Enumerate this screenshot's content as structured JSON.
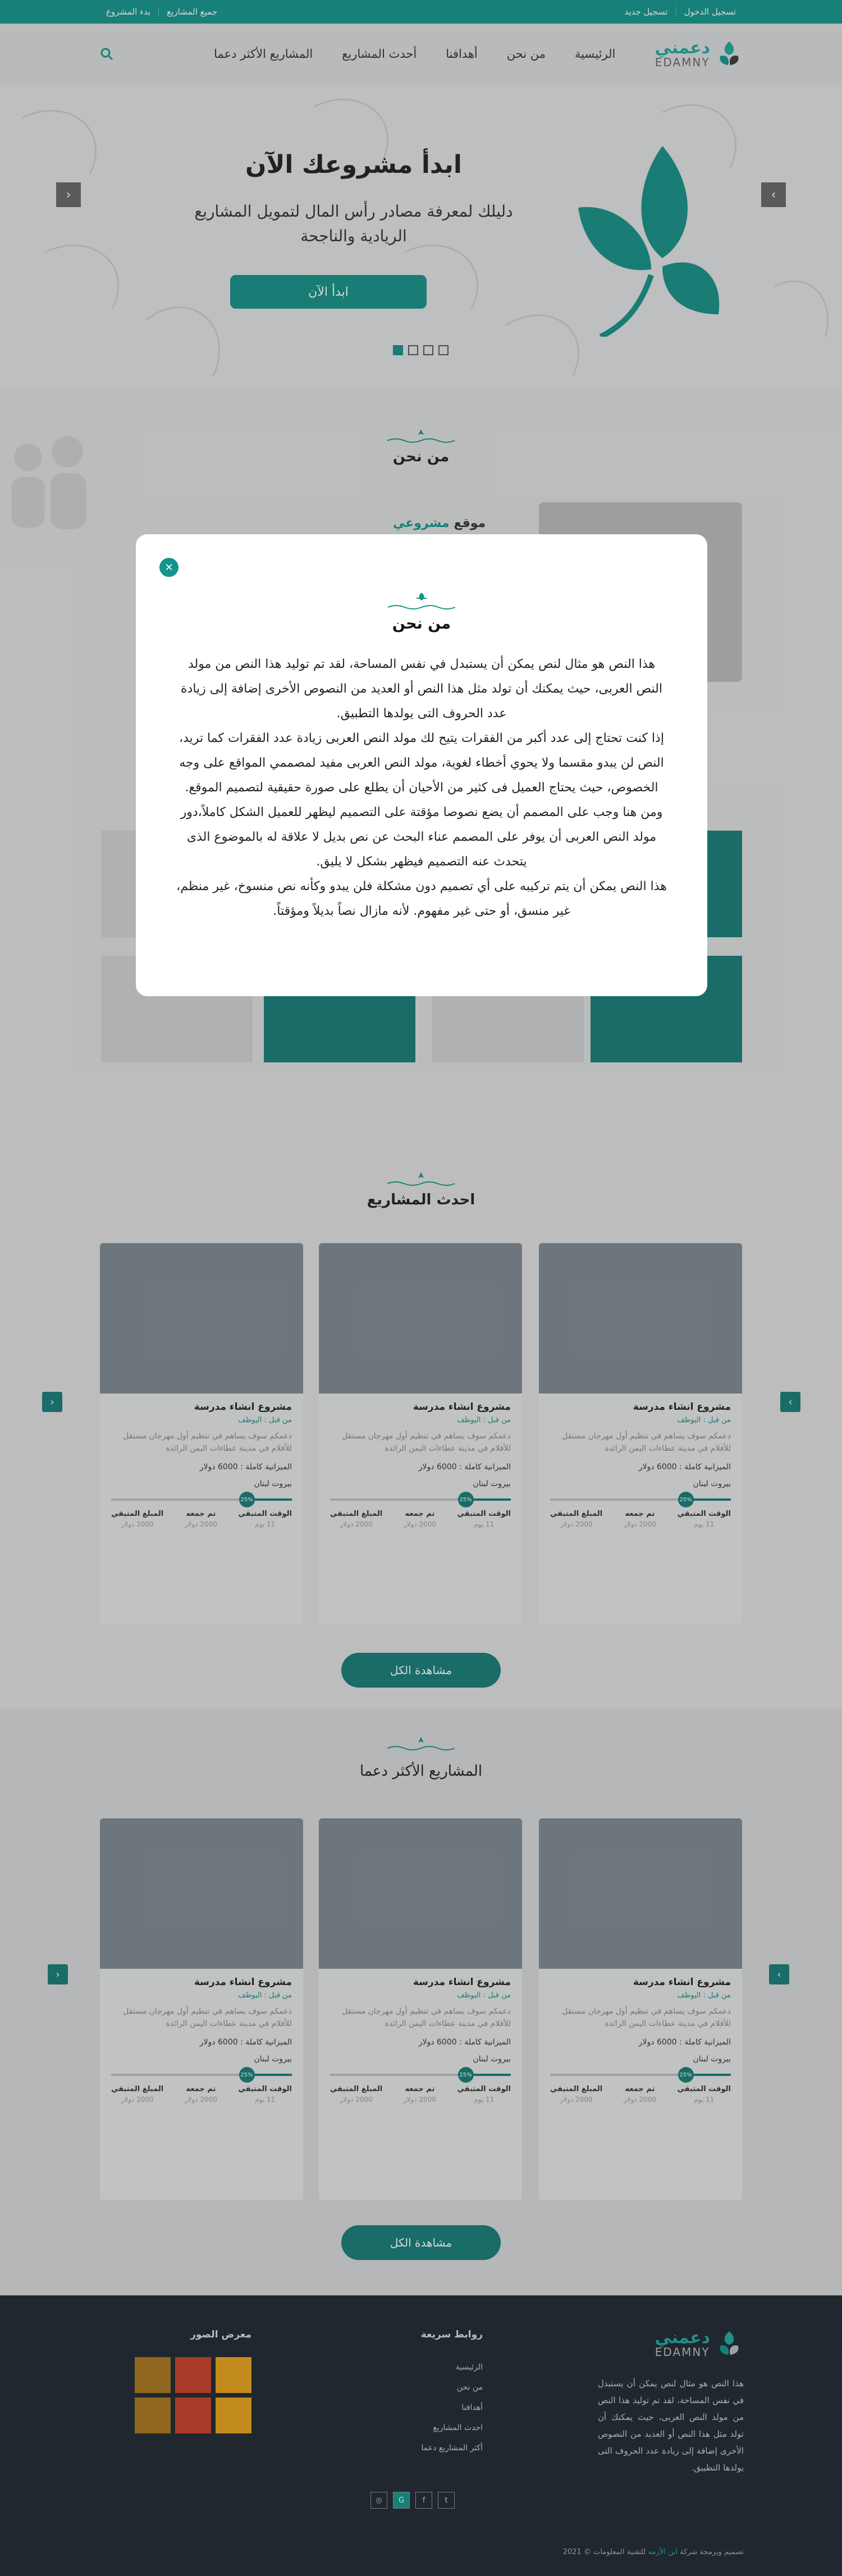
{
  "topbar": {
    "register": "تسجيل جديد",
    "login": "تسجيل الدخول",
    "all_projects": "جميع المشاريع",
    "start_project": "بدء المشروع"
  },
  "header": {
    "logo_ar": "دعمني",
    "logo_en": "EDAMNY",
    "nav": [
      "الرئيسية",
      "من نحن",
      "أهدافنا",
      "أحدث المشاريع",
      "المشاريع الأكثر دعما"
    ]
  },
  "hero": {
    "title": "ابدأ مشروعك الآن",
    "subtitle": "دليلك لمعرفة مصادر رأس المال لتمويل المشاريع الريادية والناجحة",
    "button": "ابدأ الآن",
    "prev": "‹",
    "next": "›"
  },
  "about": {
    "title": "من نحن",
    "site_prefix": "موقع",
    "site_name": "مشروعي"
  },
  "projects": {
    "title": "احدث المشاريع",
    "view_all": "مشاهدة الكل",
    "cards": [
      {
        "title": "مشروع انشاء مدرسة",
        "by": "من قبل : اليوظف",
        "desc": "دعمكم سوف يساهم في تنظيم أول مهرجان مستقل للأفلام في مدينة عطاءات اليمن الرائدة",
        "budget": "الميزانية كاملة : 6000 دولار",
        "location": "بيروت لبنان",
        "progress": "25%",
        "remaining_label": "الوقت المتبقي",
        "remaining": "11 يوم",
        "donors_label": "تم جمعه",
        "donors": "2000 دولار",
        "goal_label": "المبلغ المتبقي",
        "goal": "2000 دولار"
      },
      {
        "title": "مشروع انشاء مدرسة",
        "by": "من قبل : اليوظف",
        "desc": "دعمكم سوف يساهم في تنظيم أول مهرجان مستقل للأفلام في مدينة عطاءات اليمن الرائدة",
        "budget": "الميزانية كاملة : 6000 دولار",
        "location": "بيروت لبنان",
        "progress": "25%",
        "remaining_label": "الوقت المتبقي",
        "remaining": "11 يوم",
        "donors_label": "تم جمعه",
        "donors": "2000 دولار",
        "goal_label": "المبلغ المتبقي",
        "goal": "2000 دولار"
      },
      {
        "title": "مشروع انشاء مدرسة",
        "by": "من قبل : اليوظف",
        "desc": "دعمكم سوف يساهم في تنظيم أول مهرجان مستقل للأفلام في مدينة عطاءات اليمن الرائدة",
        "budget": "الميزانية كاملة : 6000 دولار",
        "location": "بيروت لبنان",
        "progress": "25%",
        "remaining_label": "الوقت المتبقي",
        "remaining": "11 يوم",
        "donors_label": "تم جمعه",
        "donors": "2000 دولار",
        "goal_label": "المبلغ المتبقي",
        "goal": "2000 دولار"
      }
    ]
  },
  "supported": {
    "title": "المشاريع الأكثر دعما",
    "view_all": "مشاهدة الكل"
  },
  "footer": {
    "about": "هذا النص هو مثال لنص يمكن أن يستبدل في نفس المساحة، لقد تم توليد هذا النص من مولد النص العربى، حيث يمكنك أن تولد مثل هذا النص أو العديد من النصوص الأخرى إضافة إلى زيادة عدد الحروف التى يولدها التطبيق.",
    "links_title": "روابط سريعة",
    "links": [
      "الرئيسية",
      "من نحن",
      "أهدافنا",
      "احدث المشاريع",
      "أكثر المشاريع دعما"
    ],
    "gallery_title": "معرض الصور",
    "copyright_prefix": "تصميم وبرمجة شركة",
    "copyright_company": "ابن الأزمه",
    "copyright_suffix": "للتقنية المعلومات © 2021"
  },
  "modal": {
    "title": "من نحن",
    "paragraphs": [
      "هذا النص هو مثال لنص يمكن أن يستبدل في نفس المساحة، لقد تم توليد هذا النص من مولد النص العربى، حيث يمكنك أن تولد مثل هذا النص أو العديد من النصوص الأخرى إضافة إلى زيادة عدد الحروف التى يولدها التطبيق.",
      "إذا كنت تحتاج إلى عدد أكبر من الفقرات يتيح لك مولد النص العربى زيادة عدد الفقرات كما تريد، النص لن يبدو مقسما ولا يحوي أخطاء لغوية، مولد النص العربى مفيد لمصممي المواقع على وجه الخصوص، حيث يحتاج العميل فى كثير من الأحيان أن يطلع على صورة حقيقية لتصميم الموقع.",
      "ومن هنا وجب على المصمم أن يضع نصوصا مؤقتة على التصميم ليظهر للعميل الشكل كاملاً،دور مولد النص العربى أن يوفر على المصمم عناء البحث عن نص بديل لا علاقة له بالموضوع الذى يتحدث عنه التصميم فيظهر بشكل لا يليق.",
      "هذا النص يمكن أن يتم تركيبه على أي تصميم دون مشكلة فلن يبدو وكأنه نص منسوخ، غير منظم، غير منسق، أو حتى غير مفهوم. لأنه مازال نصاً بديلاً ومؤقتاً."
    ],
    "close_icon": "✕"
  },
  "colors": {
    "brand": "#14948c",
    "dark": "#1f2830"
  }
}
